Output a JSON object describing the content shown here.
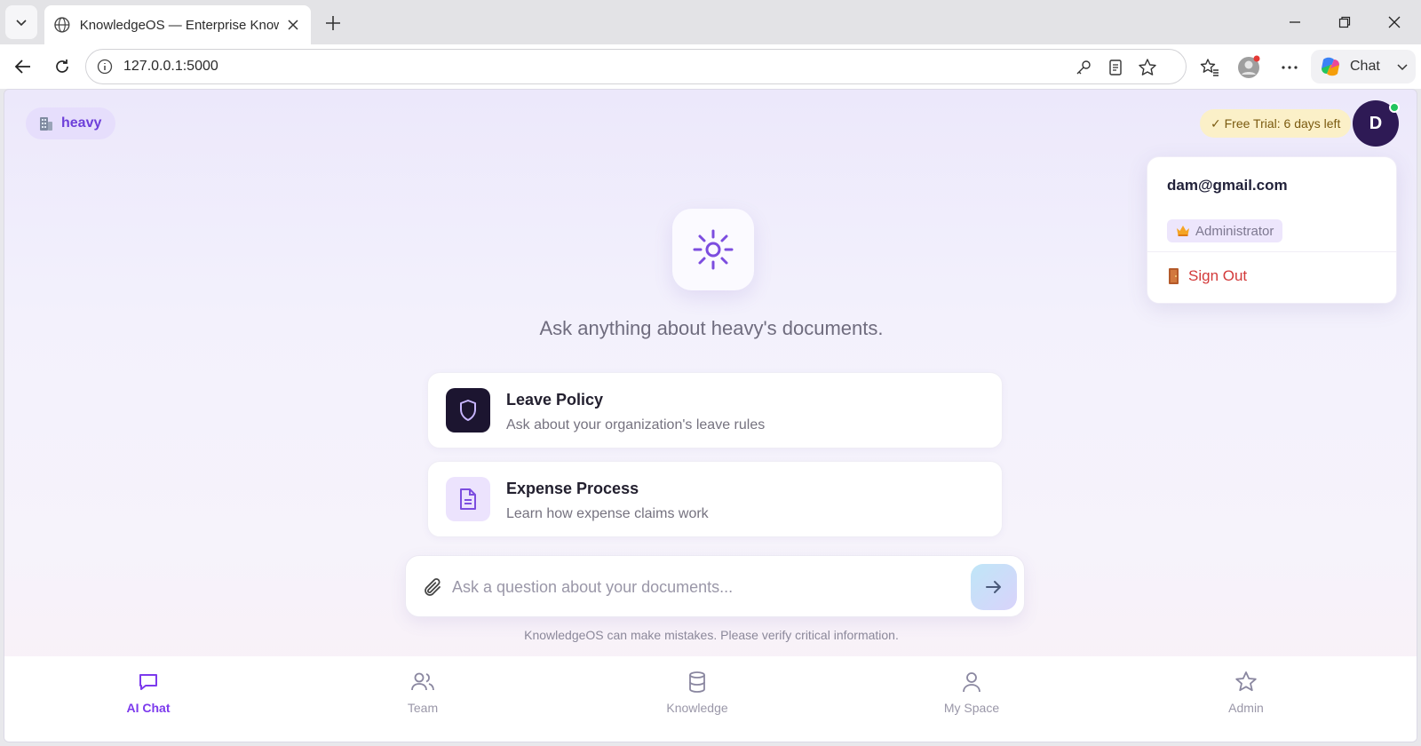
{
  "browser": {
    "tab_title": "KnowledgeOS — Enterprise Knowl",
    "url": "127.0.0.1:5000",
    "chat_label": "Chat"
  },
  "app": {
    "org_name": "heavy",
    "trial": "✓ Free Trial: 6 days left",
    "avatar_initial": "D",
    "user_menu": {
      "email": "dam@gmail.com",
      "role": "Administrator",
      "sign_out": "Sign Out"
    },
    "hero_text": "Ask anything about heavy's documents.",
    "suggestions": [
      {
        "title": "Leave Policy",
        "description": "Ask about your organization's leave rules",
        "icon": "shield-icon"
      },
      {
        "title": "Expense Process",
        "description": "Learn how expense claims work",
        "icon": "document-icon"
      }
    ],
    "composer": {
      "placeholder": "Ask a question about your documents..."
    },
    "disclaimer": "KnowledgeOS can make mistakes. Please verify critical information.",
    "nav": [
      {
        "label": "AI Chat",
        "icon": "chat-icon",
        "active": true
      },
      {
        "label": "Team",
        "icon": "users-icon",
        "active": false
      },
      {
        "label": "Knowledge",
        "icon": "database-icon",
        "active": false
      },
      {
        "label": "My Space",
        "icon": "user-icon",
        "active": false
      },
      {
        "label": "Admin",
        "icon": "star-icon",
        "active": false
      }
    ]
  },
  "colors": {
    "accent": "#7c3aed",
    "avatar_bg": "#2e1a55",
    "sign_out": "#d33a3a",
    "trial_bg": "#fbf0c8"
  }
}
